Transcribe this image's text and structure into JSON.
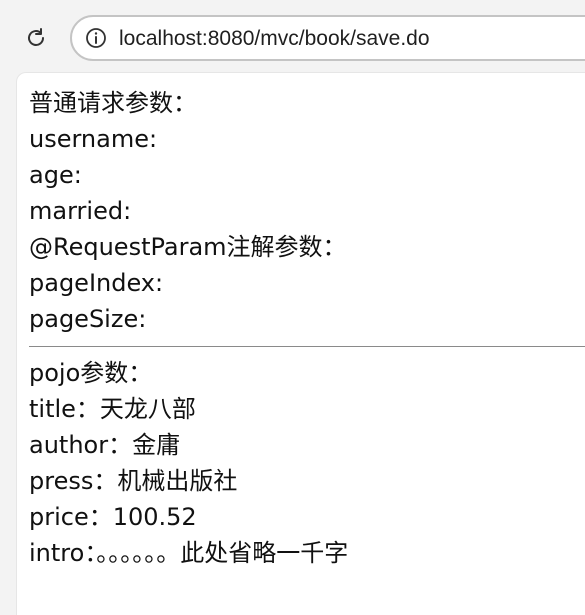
{
  "browser": {
    "url": "localhost:8080/mvc/book/save.do",
    "reload_icon": "reload-icon",
    "info_icon": "info-icon"
  },
  "page": {
    "section1": {
      "heading": "普通请求参数：",
      "lines": [
        "username:",
        "age:",
        "married:"
      ]
    },
    "section2": {
      "heading": "@RequestParam注解参数：",
      "lines": [
        "pageIndex:",
        "pageSize:"
      ]
    },
    "section3": {
      "heading": "pojo参数：",
      "lines": [
        "title：天龙八部",
        "author：金庸",
        "press：机械出版社",
        "price：100.52",
        "intro：。。。。。。此处省略一千字"
      ]
    }
  }
}
